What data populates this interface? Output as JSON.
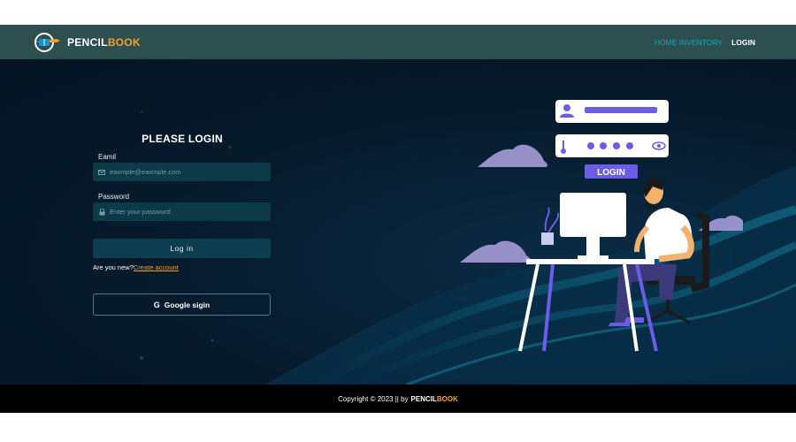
{
  "header": {
    "brand_main": "PENCIL",
    "brand_accent": "BOOK",
    "logo_icon": "book-pencil-logo-icon",
    "nav": {
      "home_label": "HOME INVENTORY",
      "login_label": "LOGIN"
    }
  },
  "form": {
    "title": "PLEASE LOGIN",
    "email_label": "Eamil",
    "email_placeholder": "eaxmple@eaxmple.com",
    "email_icon": "envelope-icon",
    "password_label": "Password",
    "password_placeholder": "Enter your password",
    "password_icon": "lock-icon",
    "login_button": "Log in",
    "new_prompt": "Are you new?",
    "create_link": "Create account",
    "google_icon": "google-g-icon",
    "google_glyph": "G",
    "google_button": "Google sigin"
  },
  "illustration": {
    "login_label": "LOGIN"
  },
  "footer": {
    "copyright": "Copyright © 2023 || by",
    "brand_main": "PENCIL",
    "brand_accent": "BOOK"
  },
  "colors": {
    "header_bg": "#2d4f4f",
    "accent": "#f2a12b",
    "nav_active": "#1aa6b6",
    "main_bg": "#061a2b",
    "field_bg": "#0b3a49",
    "footer_bg": "#000000",
    "purple": "#6c5ce7"
  }
}
